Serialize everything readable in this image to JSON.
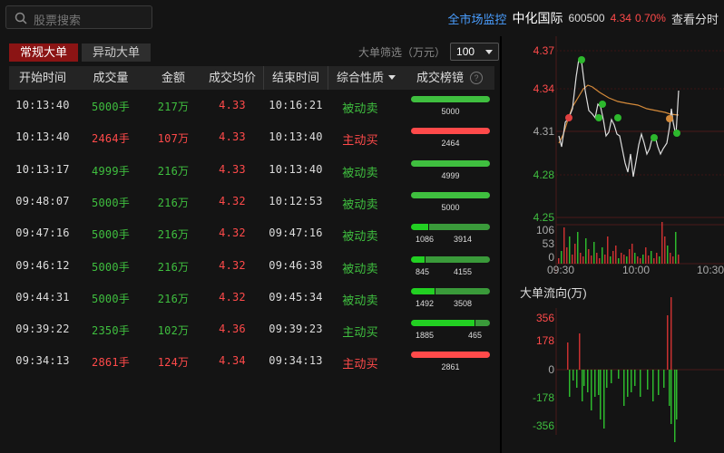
{
  "search": {
    "placeholder": "股票搜索"
  },
  "header": {
    "market_monitor": "全市场监控",
    "stock_name": "中化国际",
    "stock_code": "600500",
    "price": "4.34",
    "change_pct": "0.70%",
    "view_intraday": "查看分时"
  },
  "tabs": [
    {
      "label": "常规大单",
      "active": true
    },
    {
      "label": "异动大单",
      "active": false
    }
  ],
  "filter": {
    "label": "大单筛选（万元）",
    "value": "100"
  },
  "table": {
    "columns": [
      "开始时间",
      "成交量",
      "金额",
      "成交均价",
      "结束时间",
      "综合性质",
      "成交榜镜"
    ],
    "rows": [
      {
        "start": "10:13:40",
        "vol": "5000手",
        "amt": "217万",
        "avg": "4.33",
        "end": "10:16:21",
        "nature": "被动卖",
        "color": "green",
        "buy": 0,
        "sell": 5000,
        "label": "5000"
      },
      {
        "start": "10:13:40",
        "vol": "2464手",
        "amt": "107万",
        "avg": "4.33",
        "end": "10:13:40",
        "nature": "主动买",
        "color": "red",
        "buy": 2464,
        "sell": 0,
        "label": "2464"
      },
      {
        "start": "10:13:17",
        "vol": "4999手",
        "amt": "216万",
        "avg": "4.33",
        "end": "10:13:40",
        "nature": "被动卖",
        "color": "green",
        "buy": 0,
        "sell": 4999,
        "label": "4999"
      },
      {
        "start": "09:48:07",
        "vol": "5000手",
        "amt": "216万",
        "avg": "4.32",
        "end": "10:12:53",
        "nature": "被动卖",
        "color": "green",
        "buy": 0,
        "sell": 5000,
        "label": "5000"
      },
      {
        "start": "09:47:16",
        "vol": "5000手",
        "amt": "216万",
        "avg": "4.32",
        "end": "09:47:16",
        "nature": "被动卖",
        "color": "green",
        "split": [
          "1086",
          "3914"
        ],
        "first": 1086,
        "second": 3914
      },
      {
        "start": "09:46:12",
        "vol": "5000手",
        "amt": "216万",
        "avg": "4.32",
        "end": "09:46:38",
        "nature": "被动卖",
        "color": "green",
        "split": [
          "845",
          "4155"
        ],
        "first": 845,
        "second": 4155
      },
      {
        "start": "09:44:31",
        "vol": "5000手",
        "amt": "216万",
        "avg": "4.32",
        "end": "09:45:34",
        "nature": "被动卖",
        "color": "green",
        "split": [
          "1492",
          "3508"
        ],
        "first": 1492,
        "second": 3508
      },
      {
        "start": "09:39:22",
        "vol": "2350手",
        "amt": "102万",
        "avg": "4.36",
        "end": "09:39:23",
        "nature": "主动买",
        "color": "green",
        "split": [
          "1885",
          "465"
        ],
        "first": 1885,
        "second": 465
      },
      {
        "start": "09:34:13",
        "vol": "2861手",
        "amt": "124万",
        "avg": "4.34",
        "end": "09:34:13",
        "nature": "主动买",
        "color": "red",
        "buy": 2861,
        "sell": 0,
        "label": "2861"
      }
    ]
  },
  "price_chart": {
    "y_ticks": [
      "4.37",
      "4.34",
      "4.31",
      "4.28",
      "4.25"
    ],
    "vol_ticks": [
      "106",
      "53",
      "0"
    ],
    "x_ticks": [
      "09:30",
      "10:00",
      "10:30"
    ]
  },
  "flow_chart": {
    "title": "大单流向(万)",
    "y_ticks": [
      "356",
      "178",
      "0",
      "-178",
      "-356"
    ]
  },
  "colors": {
    "green": "#3fbf3f",
    "red": "#ff4a4a",
    "accent_blue": "#4a9eff",
    "tab_active": "#8b1414"
  }
}
